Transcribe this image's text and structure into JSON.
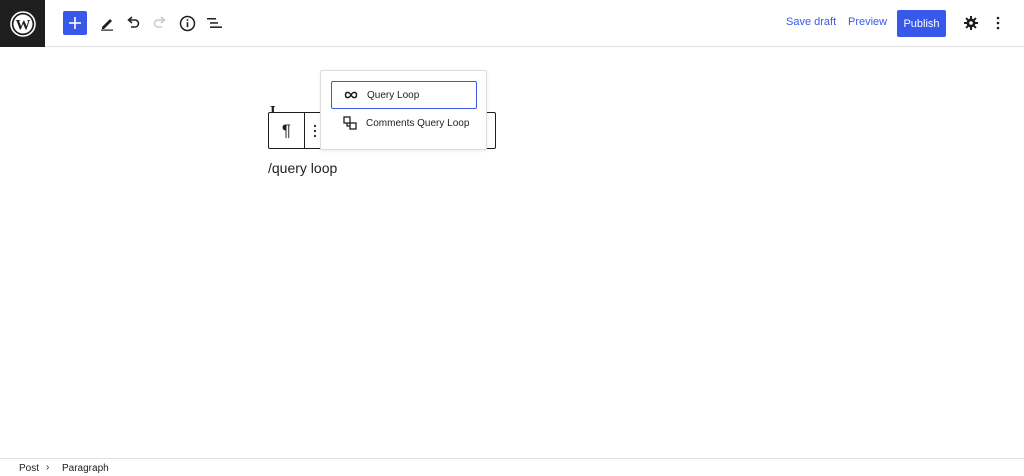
{
  "header": {
    "logo_icon": "wordpress-logo-icon",
    "inserter_icon": "plus-icon",
    "tools": [
      "pencil-icon",
      "undo-icon",
      "redo-icon",
      "info-icon",
      "list-view-icon"
    ],
    "save_draft": "Save draft",
    "preview": "Preview",
    "publish": "Publish",
    "settings_icon": "gear-icon",
    "more_icon": "kebab-icon",
    "accent_color": "#3858e9"
  },
  "editor": {
    "paragraph_text": "/query loop",
    "block_type_icon": "¶"
  },
  "popover": {
    "options": [
      {
        "label": "Query Loop",
        "icon": "loop-icon",
        "selected": true
      },
      {
        "label": "Comments Query Loop",
        "icon": "comments-query-icon",
        "selected": false
      }
    ]
  },
  "footer": {
    "breadcrumb": [
      "Post",
      "Paragraph"
    ],
    "separator": "›"
  }
}
